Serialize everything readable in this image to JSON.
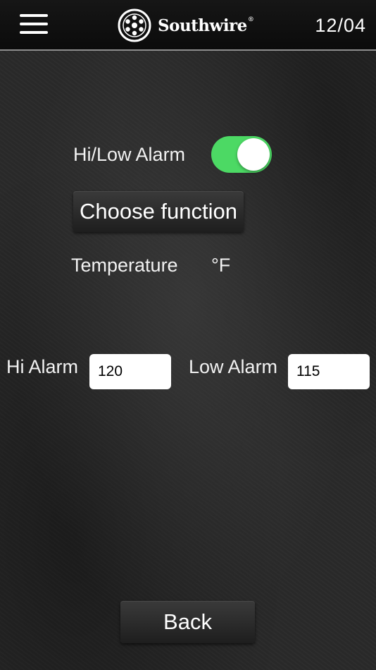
{
  "header": {
    "menu_icon": "hamburger-menu-icon",
    "brand": "Southwire",
    "brand_mark": "®",
    "date": "12/04"
  },
  "alarm": {
    "toggle_label": "Hi/Low Alarm",
    "toggle_on": true,
    "toggle_color": "#4cd964"
  },
  "function": {
    "button_label": "Choose function",
    "selected_label": "Temperature",
    "unit": "°F"
  },
  "limits": {
    "hi_label": "Hi Alarm",
    "hi_value": "120",
    "low_label": "Low Alarm",
    "low_value": "115"
  },
  "footer": {
    "back_label": "Back"
  }
}
